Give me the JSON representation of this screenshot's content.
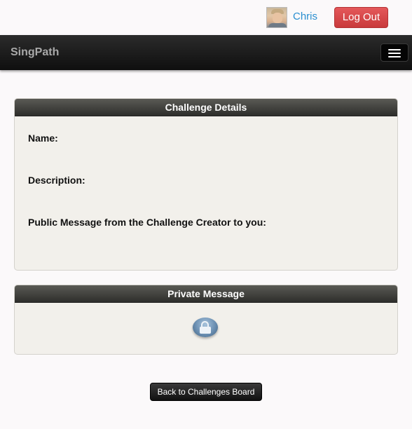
{
  "header": {
    "user_name": "Chris",
    "logout_label": "Log Out"
  },
  "navbar": {
    "brand": "SingPath"
  },
  "challenge_details": {
    "title": "Challenge Details",
    "name_label": "Name:",
    "description_label": "Description:",
    "public_message_label": "Public Message from the Challenge Creator to you:"
  },
  "private_message": {
    "title": "Private Message",
    "icon": "lock-icon"
  },
  "footer": {
    "back_label": "Back to Challenges Board"
  },
  "colors": {
    "logout": "#d9484a",
    "link": "#2a8fd0",
    "navbar": "#1a1a1a"
  }
}
